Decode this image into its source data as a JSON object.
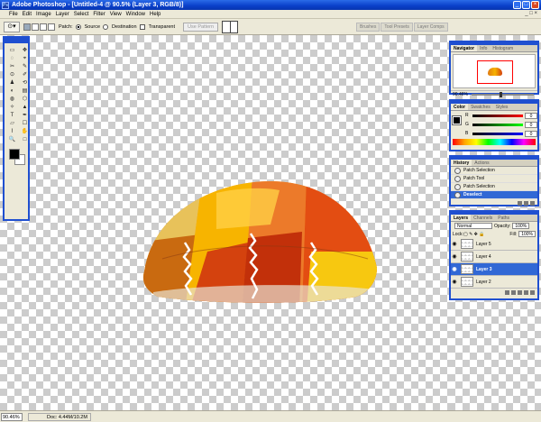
{
  "window": {
    "title": "Adobe Photoshop - [Untitled-4 @ 90.5% (Layer 3, RGB/8)]",
    "app_icon": "Ps",
    "controls": [
      "_",
      "□",
      "×"
    ]
  },
  "menu": [
    "File",
    "Edit",
    "Image",
    "Layer",
    "Select",
    "Filter",
    "View",
    "Window",
    "Help"
  ],
  "doc_close": "_ □ ×",
  "options_bar": {
    "patch_label": "Patch:",
    "source_label": "Source",
    "destination_label": "Destination",
    "transparent_label": "Transparent",
    "use_pattern_label": "Use Pattern",
    "source_selected": true
  },
  "palette_wells": [
    "Brushes",
    "Tool Presets",
    "Layer Comps"
  ],
  "toolbox": {
    "tools": [
      "▭",
      "✥",
      "◌",
      "⌖",
      "✂",
      "✎",
      "⊙",
      "✐",
      "♟",
      "⟲",
      "◐",
      "▤",
      "◍",
      "⬡",
      "✧",
      "▲",
      "T",
      "✒",
      "▱",
      "☐",
      "⌇",
      "✋",
      "🔍",
      "□"
    ]
  },
  "navigator": {
    "tabs": [
      "Navigator",
      "Info",
      "Histogram"
    ],
    "zoom": "90.46%"
  },
  "color_panel": {
    "tabs": [
      "Color",
      "Swatches",
      "Styles"
    ],
    "channels": [
      {
        "label": "R",
        "value": "0",
        "gradient": "#ff0000"
      },
      {
        "label": "G",
        "value": "0",
        "gradient": "#00ff00"
      },
      {
        "label": "B",
        "value": "0",
        "gradient": "#0000ff"
      }
    ]
  },
  "history": {
    "tabs": [
      "History",
      "Actions"
    ],
    "items": [
      "Patch Selection",
      "Patch Tool",
      "Patch Selection",
      "Deselect"
    ],
    "active_index": 3
  },
  "layers": {
    "tabs": [
      "Layers",
      "Channels",
      "Paths"
    ],
    "blend_mode": "Normal",
    "opacity_label": "Opacity:",
    "opacity": "100%",
    "lock_label": "Lock:",
    "fill_label": "Fill:",
    "fill": "100%",
    "items": [
      "Layer 5",
      "Layer 4",
      "Layer 3",
      "Layer 2"
    ],
    "active_index": 2
  },
  "status": {
    "zoom": "90.46%",
    "doc": "Doc: 4.44M/10.2M"
  }
}
